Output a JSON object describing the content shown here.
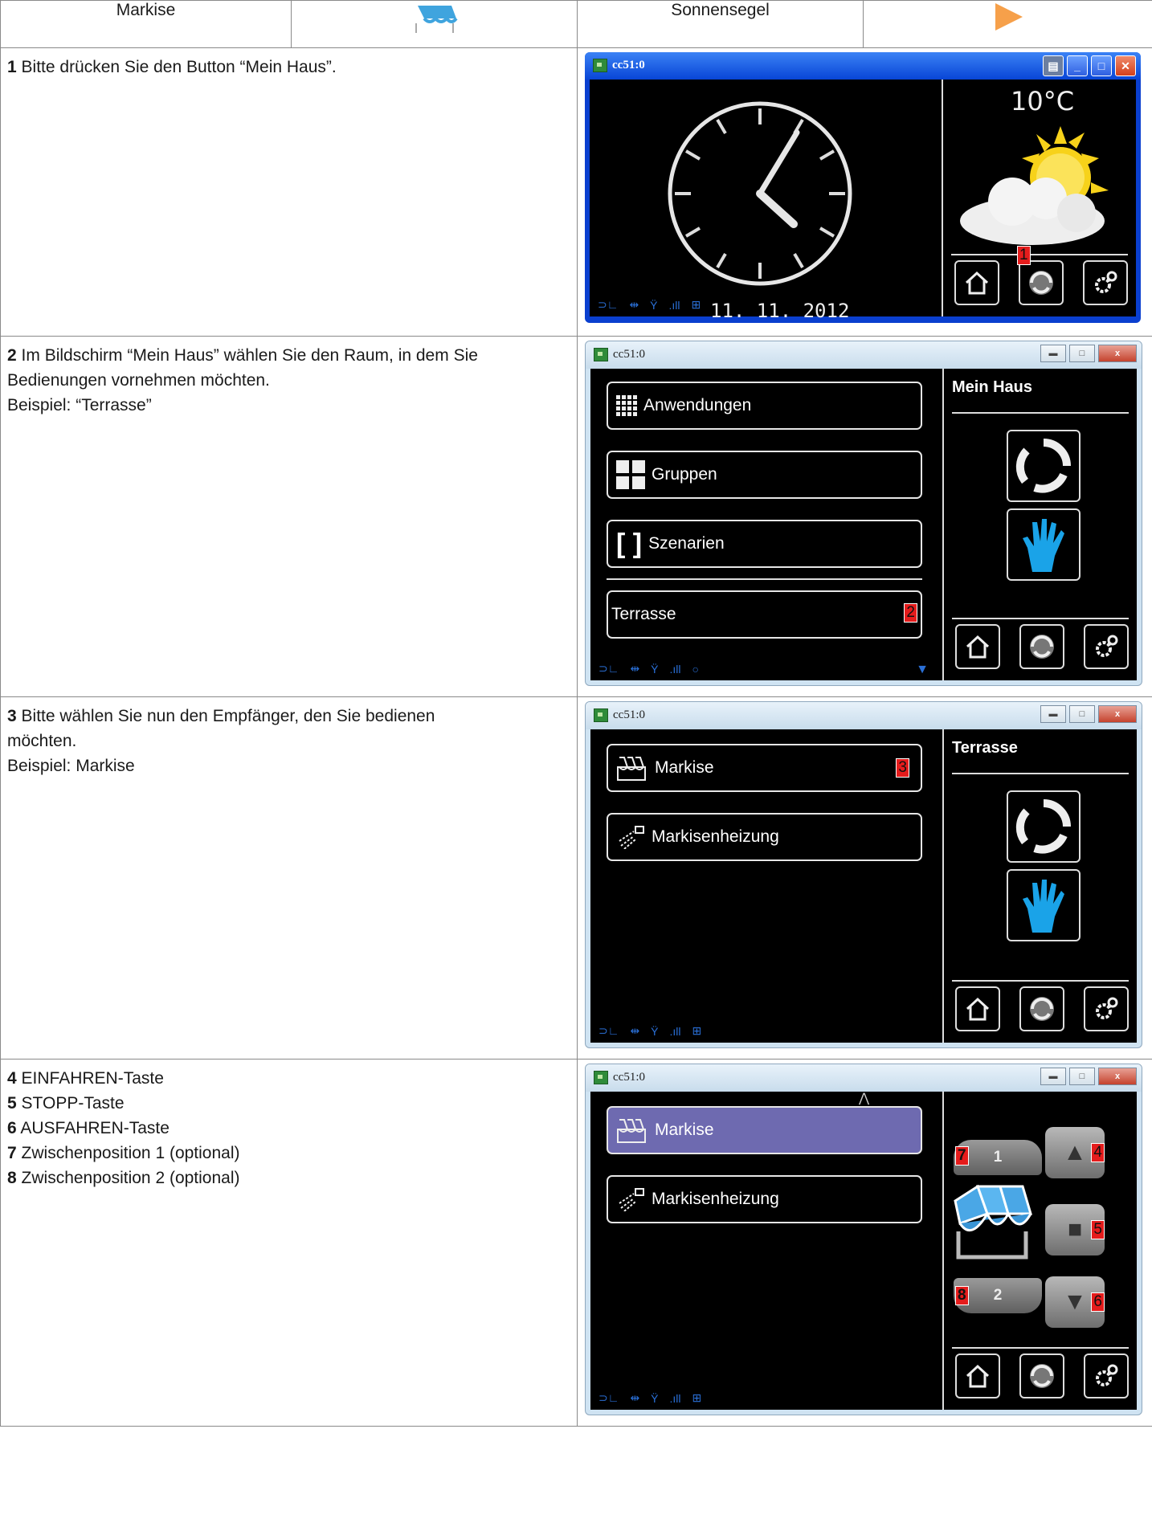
{
  "header": {
    "col1": "Markise",
    "col3": "Sonnensegel"
  },
  "colors": {
    "accent_orange": "#f6a04a",
    "awning_blue": "#3fa4de",
    "selected_row": "#6e6ab0",
    "marker_red": "#e51c1c"
  },
  "rows": [
    {
      "num": "1",
      "lines": [
        "Bitte drücken Sie den Button “Mein Haus”."
      ],
      "screen": {
        "title": "cc51:0",
        "temperature": "10°C",
        "date": "11. 11. 2012",
        "marker": "1",
        "icons": [
          "clock-icon",
          "weather-sun-cloud-icon",
          "home-icon",
          "mein-haus-icon",
          "settings-icon"
        ]
      }
    },
    {
      "num": "2",
      "lines": [
        "Im Bildschirm “Mein Haus” wählen Sie den Raum, in dem Sie",
        "Bedienungen vornehmen möchten.",
        "Beispiel: “Terrasse”"
      ],
      "screen": {
        "title": "cc51:0",
        "right_title": "Mein Haus",
        "menu": [
          "Anwendungen",
          "Gruppen",
          "Szenarien",
          "Terrasse"
        ],
        "marker": "2"
      }
    },
    {
      "num": "3",
      "lines": [
        "Bitte wählen Sie nun den Empfänger, den Sie bedienen",
        "möchten.",
        "Beispiel: Markise"
      ],
      "screen": {
        "title": "cc51:0",
        "right_title": "Terrasse",
        "menu": [
          "Markise",
          "Markisenheizung"
        ],
        "marker": "3"
      }
    },
    {
      "items": [
        {
          "num": "4",
          "text": "EINFAHREN-Taste"
        },
        {
          "num": "5",
          "text": "STOPP-Taste"
        },
        {
          "num": "6",
          "text": "AUSFAHREN-Taste"
        },
        {
          "num": "7",
          "text": "Zwischenposition 1 (optional)"
        },
        {
          "num": "8",
          "text": "Zwischenposition 2 (optional)"
        }
      ],
      "screen": {
        "title": "cc51:0",
        "menu": [
          "Markise",
          "Markisenheizung"
        ],
        "pos1": "1",
        "pos2": "2",
        "markers": [
          "4",
          "5",
          "6",
          "7",
          "8"
        ]
      }
    }
  ]
}
